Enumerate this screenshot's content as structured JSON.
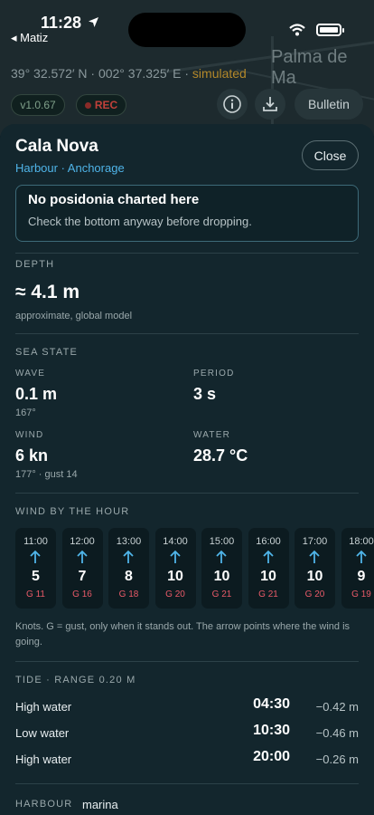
{
  "status": {
    "time": "11:28",
    "back": "◂ Matiz"
  },
  "map": {
    "place": "Palma de Ma",
    "coords": "39° 32.572′ N · 002° 37.325′ E ·",
    "coords_tag": "simulated",
    "version": "v1.0.67",
    "rec": "REC",
    "bulletin": "Bulletin"
  },
  "sheet": {
    "title": "Cala Nova",
    "subtitle": "Harbour · Anchorage",
    "close": "Close",
    "notice": {
      "title": "No posidonia charted here",
      "body": "Check the bottom anyway before dropping."
    },
    "depth": {
      "label": "DEPTH",
      "value": "≈ 4.1 m",
      "note": "approximate, global model"
    },
    "sea": {
      "label": "SEA STATE",
      "wave": {
        "label": "WAVE",
        "value": "0.1 m",
        "note": "167°"
      },
      "period": {
        "label": "PERIOD",
        "value": "3 s"
      },
      "wind": {
        "label": "WIND",
        "value": "6 kn",
        "note": "177° · gust 14"
      },
      "water": {
        "label": "WATER",
        "value": "28.7 °C"
      }
    },
    "hourly": {
      "label": "WIND BY THE HOUR",
      "hours": [
        {
          "time": "11:00",
          "speed": "5",
          "gust": "G 11"
        },
        {
          "time": "12:00",
          "speed": "7",
          "gust": "G 16"
        },
        {
          "time": "13:00",
          "speed": "8",
          "gust": "G 18"
        },
        {
          "time": "14:00",
          "speed": "10",
          "gust": "G 20"
        },
        {
          "time": "15:00",
          "speed": "10",
          "gust": "G 21"
        },
        {
          "time": "16:00",
          "speed": "10",
          "gust": "G 21"
        },
        {
          "time": "17:00",
          "speed": "10",
          "gust": "G 20"
        },
        {
          "time": "18:00",
          "speed": "9",
          "gust": "G 19"
        }
      ],
      "note": "Knots. G = gust, only when it stands out. The arrow points where the wind is going."
    },
    "tide": {
      "label": "TIDE · RANGE 0.20 M",
      "rows": [
        {
          "name": "High water",
          "time": "04:30",
          "height": "−0.42 m"
        },
        {
          "name": "Low water",
          "time": "10:30",
          "height": "−0.46 m"
        },
        {
          "name": "High water",
          "time": "20:00",
          "height": "−0.26 m"
        }
      ]
    },
    "harbour": {
      "label": "HARBOUR",
      "value": "marina"
    }
  },
  "colors": {
    "accent": "#4fb4e8",
    "gust": "#e85a68",
    "sheet": "#13262d",
    "simulated": "#b3882a"
  }
}
